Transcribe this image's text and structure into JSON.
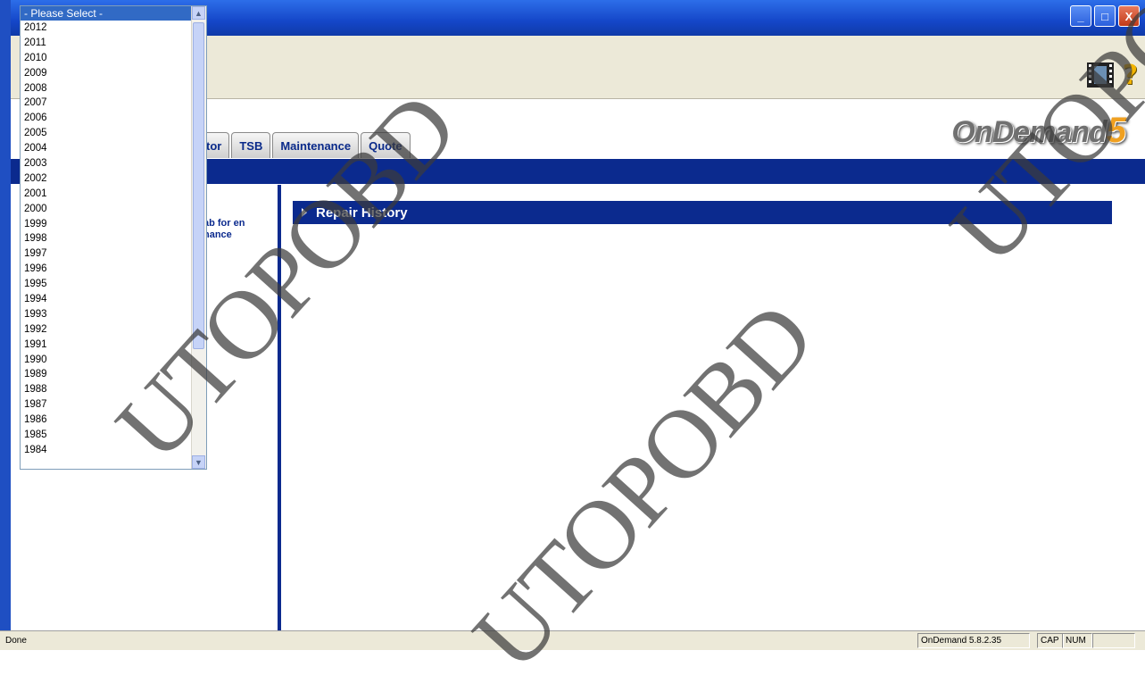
{
  "window": {
    "minimize": "_",
    "maximize": "□",
    "close": "X"
  },
  "brand": {
    "logo_main": "OnDemand",
    "logo_number": "5"
  },
  "tabs": [
    "tor",
    "TSB",
    "Maintenance",
    "Quote"
  ],
  "left_pane": {
    "text": "ab for en nance"
  },
  "content": {
    "section_title": "Repair History"
  },
  "year_dropdown": {
    "selected": "- Please Select -",
    "options": [
      "2012",
      "2011",
      "2010",
      "2009",
      "2008",
      "2007",
      "2006",
      "2005",
      "2004",
      "2003",
      "2002",
      "2001",
      "2000",
      "1999",
      "1998",
      "1997",
      "1996",
      "1995",
      "1994",
      "1993",
      "1992",
      "1991",
      "1990",
      "1989",
      "1988",
      "1987",
      "1986",
      "1985",
      "1984"
    ]
  },
  "statusbar": {
    "status": "Done",
    "version": "OnDemand 5.8.2.35",
    "cap": "CAP",
    "num": "NUM"
  },
  "watermark": "UTOPOBD",
  "icons": {
    "help": "?",
    "film": "film-icon"
  },
  "colors": {
    "accent_blue": "#0b2a8e",
    "title_blue": "#1446c8",
    "chrome": "#ece9d8"
  }
}
